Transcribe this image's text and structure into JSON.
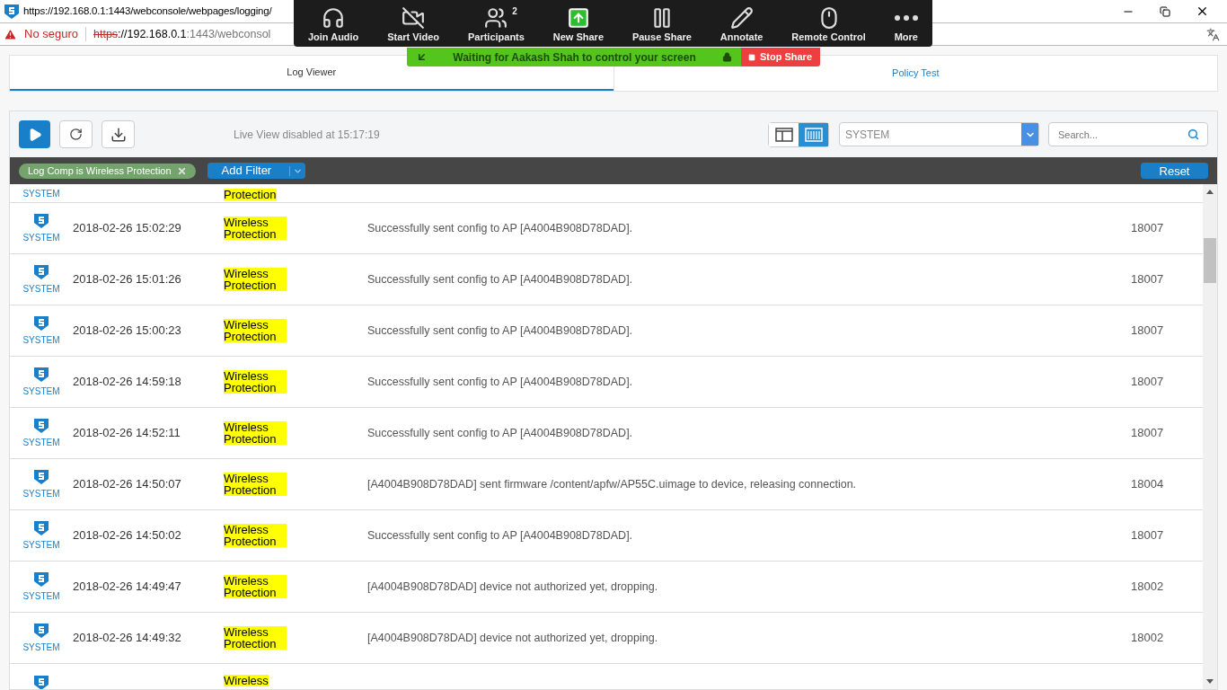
{
  "browser": {
    "title": "https://192.168.0.1:1443/webconsole/webpages/logging/",
    "security": "No seguro",
    "address": {
      "scheme": "https",
      "host": "://192.168.0.1",
      "path": ":1443/webconsol"
    }
  },
  "meeting_toolbar": {
    "buttons": [
      {
        "kind": "audio",
        "label": "Join Audio"
      },
      {
        "kind": "video",
        "label": "Start Video"
      },
      {
        "kind": "participants",
        "label": "Participants",
        "count": "2"
      },
      {
        "kind": "share",
        "label": "New Share"
      },
      {
        "kind": "pause",
        "label": "Pause Share"
      },
      {
        "kind": "annotate",
        "label": "Annotate"
      },
      {
        "kind": "remote",
        "label": "Remote Control"
      },
      {
        "kind": "more",
        "label": "More"
      }
    ],
    "banner": "Waiting for Aakash Shah to control your screen",
    "stop": "Stop Share"
  },
  "tabs": [
    {
      "label": "Log Viewer",
      "selected": true
    },
    {
      "label": "Policy Test",
      "selected": false
    }
  ],
  "toolbar": {
    "live_status": "Live View disabled at 15:17:19",
    "view_modes": [
      {
        "kind": "panes",
        "selected": false
      },
      {
        "kind": "columns",
        "selected": true
      }
    ],
    "log_type": "SYSTEM",
    "search": {
      "placeholder": "Search..."
    }
  },
  "filter_bar": {
    "filters": [
      {
        "label": "Log Comp is Wireless Protection"
      }
    ],
    "add_filter": "Add Filter",
    "reset": "Reset"
  },
  "row_top_cut": {
    "source": "SYSTEM",
    "component": "Protection"
  },
  "rows": [
    {
      "source": "SYSTEM",
      "time": "2018-02-26 15:02:29",
      "component": "Wireless Protection",
      "message": "Successfully sent config to AP [A4004B908D78DAD].",
      "id": "18007"
    },
    {
      "source": "SYSTEM",
      "time": "2018-02-26 15:01:26",
      "component": "Wireless Protection",
      "message": "Successfully sent config to AP [A4004B908D78DAD].",
      "id": "18007"
    },
    {
      "source": "SYSTEM",
      "time": "2018-02-26 15:00:23",
      "component": "Wireless Protection",
      "message": "Successfully sent config to AP [A4004B908D78DAD].",
      "id": "18007"
    },
    {
      "source": "SYSTEM",
      "time": "2018-02-26 14:59:18",
      "component": "Wireless Protection",
      "message": "Successfully sent config to AP [A4004B908D78DAD].",
      "id": "18007"
    },
    {
      "source": "SYSTEM",
      "time": "2018-02-26 14:52:11",
      "component": "Wireless Protection",
      "message": "Successfully sent config to AP [A4004B908D78DAD].",
      "id": "18007"
    },
    {
      "source": "SYSTEM",
      "time": "2018-02-26 14:50:07",
      "component": "Wireless Protection",
      "message": "[A4004B908D78DAD] sent firmware /content/apfw/AP55C.uimage to device, releasing connection.",
      "id": "18004"
    },
    {
      "source": "SYSTEM",
      "time": "2018-02-26 14:50:02",
      "component": "Wireless Protection",
      "message": "Successfully sent config to AP [A4004B908D78DAD].",
      "id": "18007"
    },
    {
      "source": "SYSTEM",
      "time": "2018-02-26 14:49:47",
      "component": "Wireless Protection",
      "message": "[A4004B908D78DAD] device not authorized yet, dropping.",
      "id": "18002"
    },
    {
      "source": "SYSTEM",
      "time": "2018-02-26 14:49:32",
      "component": "Wireless Protection",
      "message": "[A4004B908D78DAD] device not authorized yet, dropping.",
      "id": "18002"
    }
  ],
  "row_bottom_cut": {
    "component": "Wireless"
  }
}
